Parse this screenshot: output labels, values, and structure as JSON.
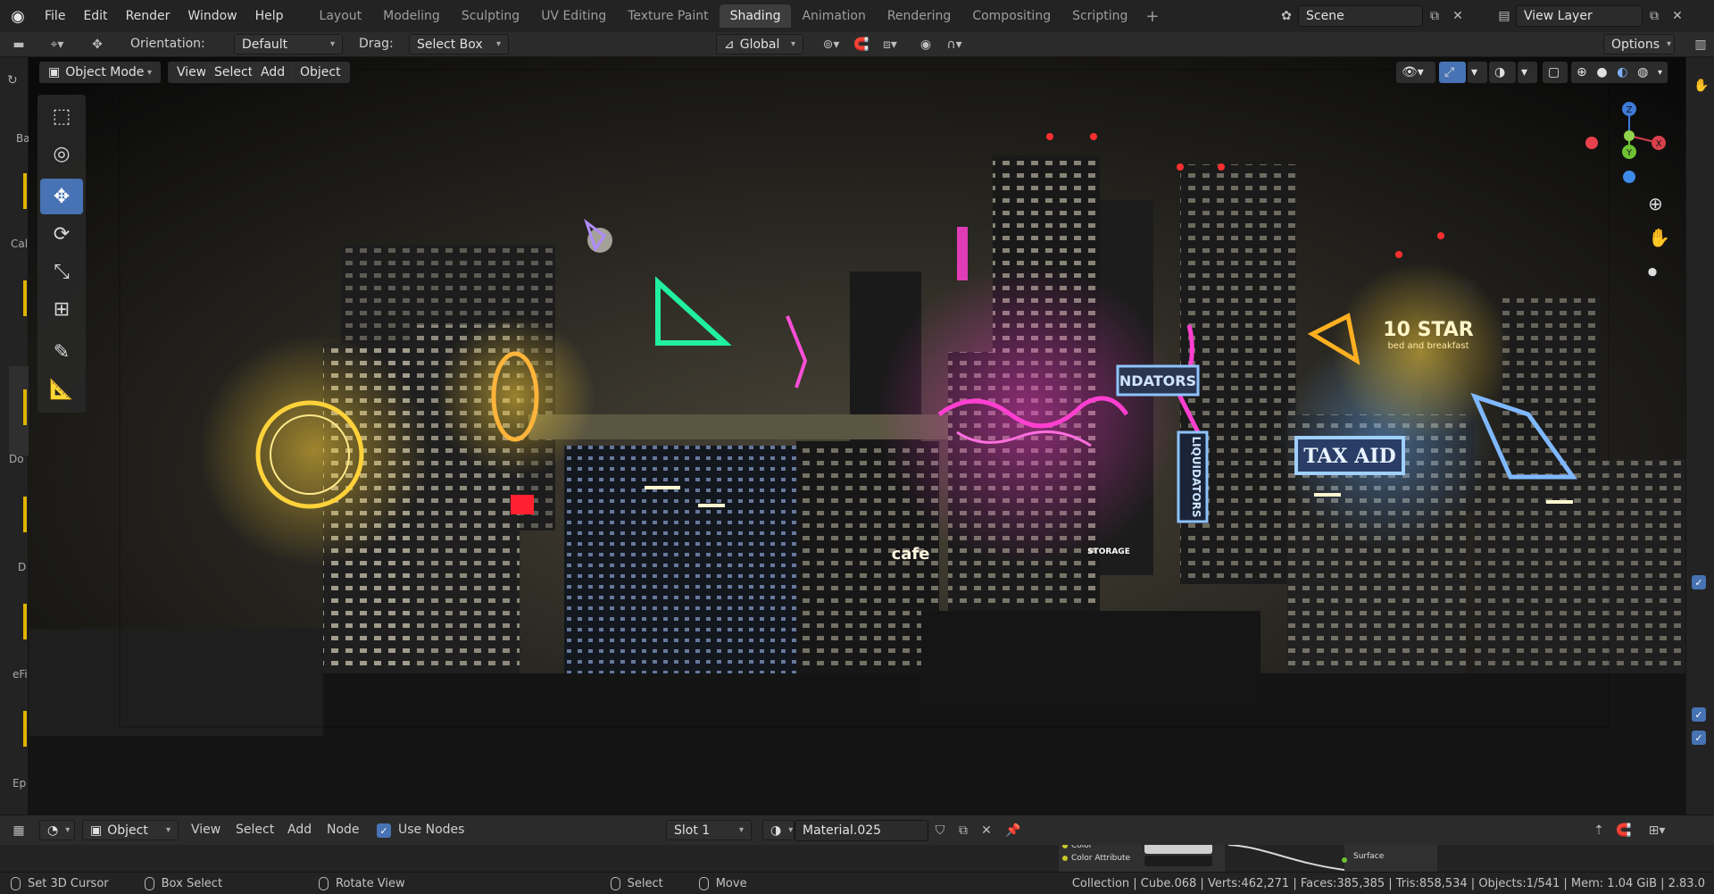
{
  "menu": [
    "File",
    "Edit",
    "Render",
    "Window",
    "Help"
  ],
  "workspaces": [
    "Layout",
    "Modeling",
    "Sculpting",
    "UV Editing",
    "Texture Paint",
    "Shading",
    "Animation",
    "Rendering",
    "Compositing",
    "Scripting"
  ],
  "active_workspace": "Shading",
  "scene": {
    "label": "Scene"
  },
  "view_layer": {
    "label": "View Layer"
  },
  "tool_header": {
    "orientation_label": "Orientation:",
    "orientation_value": "Default",
    "drag_label": "Drag:",
    "drag_value": "Select Box",
    "transform_orientation": "Global",
    "options_label": "Options"
  },
  "viewport_header": {
    "mode": "Object Mode",
    "view": "View",
    "select": "Select",
    "add": "Add",
    "object": "Object"
  },
  "gizmo": {
    "z": "Z",
    "y": "Y",
    "x": "X"
  },
  "node_header": {
    "editor_mode": "Object",
    "view": "View",
    "select": "Select",
    "add": "Add",
    "node": "Node",
    "use_nodes_label": "Use Nodes",
    "use_nodes": true,
    "slot": "Slot 1",
    "material": "Material.025"
  },
  "node_strip": {
    "color": "Color",
    "color_attribute": "Color Attribute",
    "surface": "Surface"
  },
  "statusbar": {
    "set_cursor": "Set 3D Cursor",
    "box_select": "Box Select",
    "rotate_view": "Rotate View",
    "select": "Select",
    "move": "Move",
    "stats": "Collection | Cube.068 | Verts:462,271 | Faces:385,385 | Tris:858,534 | Objects:1/541 | Mem: 1.04 GiB | 2.83.0"
  },
  "left_hints": [
    "Ba",
    "Cal",
    "Do",
    "D",
    "eFi",
    "Ep"
  ],
  "scene_signs": [
    "10 STAR",
    "bed and breakfast",
    "TAX AID",
    "LIQUIDATORS",
    "NDATORS",
    "cafe",
    "STORAGE"
  ],
  "colors": {
    "accent": "#4772b3",
    "neon_pink": "#ff3fd0",
    "neon_green": "#21f0a0",
    "neon_yellow": "#ffd23a",
    "neon_blue": "#6fb4ff"
  }
}
